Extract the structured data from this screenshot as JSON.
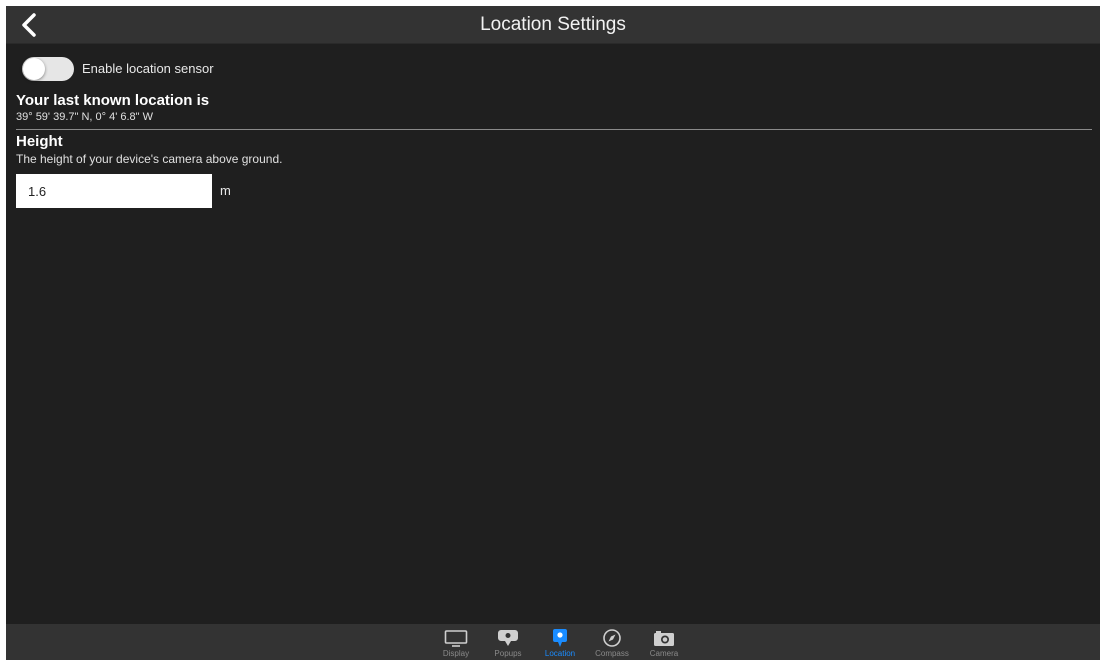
{
  "header": {
    "title": "Location Settings",
    "back_icon": "chevron-left-icon"
  },
  "location_sensor": {
    "label": "Enable location sensor",
    "enabled": false
  },
  "last_location": {
    "title": "Your last known location is",
    "coordinates": "39° 59' 39.7\" N, 0° 4' 6.8\" W"
  },
  "height": {
    "title": "Height",
    "description": "The height of your device's camera above ground.",
    "value": "1.6",
    "unit": "m"
  },
  "tabbar": {
    "active_color": "#1a8cff",
    "inactive_color": "#8a8a8a",
    "tabs": [
      {
        "label": "Display",
        "icon": "monitor-icon",
        "active": false
      },
      {
        "label": "Popups",
        "icon": "popups-icon",
        "active": false
      },
      {
        "label": "Location",
        "icon": "location-pin-icon",
        "active": true
      },
      {
        "label": "Compass",
        "icon": "compass-icon",
        "active": false
      },
      {
        "label": "Camera",
        "icon": "camera-icon",
        "active": false
      }
    ]
  }
}
